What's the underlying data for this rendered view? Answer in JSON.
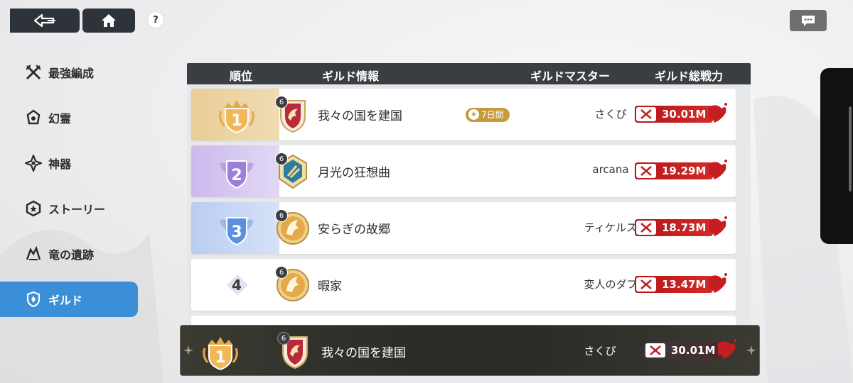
{
  "nav": {
    "back_icon": "back-arrow-icon",
    "home_icon": "home-icon",
    "help_label": "?",
    "chat_icon": "chat-bubble-icon"
  },
  "sidebar": {
    "items": [
      {
        "label": "最強編成",
        "icon": "crossed-swords-icon",
        "active": false
      },
      {
        "label": "幻霊",
        "icon": "spirit-icon",
        "active": false
      },
      {
        "label": "神器",
        "icon": "artifact-icon",
        "active": false
      },
      {
        "label": "ストーリー",
        "icon": "story-icon",
        "active": false
      },
      {
        "label": "竜の遺跡",
        "icon": "dragon-ruins-icon",
        "active": false
      },
      {
        "label": "ギルド",
        "icon": "guild-shield-icon",
        "active": true
      }
    ]
  },
  "table": {
    "headers": {
      "rank": "順位",
      "guild_info": "ギルド情報",
      "guild_master": "ギルドマスター",
      "total_power": "ギルド総戦力"
    },
    "rows": [
      {
        "rank": "1",
        "level": "6",
        "name": "我々の国を建国",
        "badge": "7日間",
        "master": "さくぴ",
        "power": "30.01M"
      },
      {
        "rank": "2",
        "level": "6",
        "name": "月光の狂想曲",
        "badge": "",
        "master": "arcana",
        "power": "19.29M"
      },
      {
        "rank": "3",
        "level": "6",
        "name": "安らぎの故郷",
        "badge": "",
        "master": "ティケルス",
        "power": "18.73M"
      },
      {
        "rank": "4",
        "level": "6",
        "name": "暇家",
        "badge": "",
        "master": "変人のダフ",
        "power": "13.47M"
      }
    ]
  },
  "my_guild": {
    "rank": "1",
    "level": "6",
    "name": "我々の国を建国",
    "master": "さくぴ",
    "power": "30.01M"
  },
  "colors": {
    "accent_blue": "#3a8fd6",
    "rank1_gold": "#e8c98e",
    "rank2_purple": "#c9b7ea",
    "rank3_blue": "#b9cdf0",
    "power_red": "#c41e22"
  }
}
